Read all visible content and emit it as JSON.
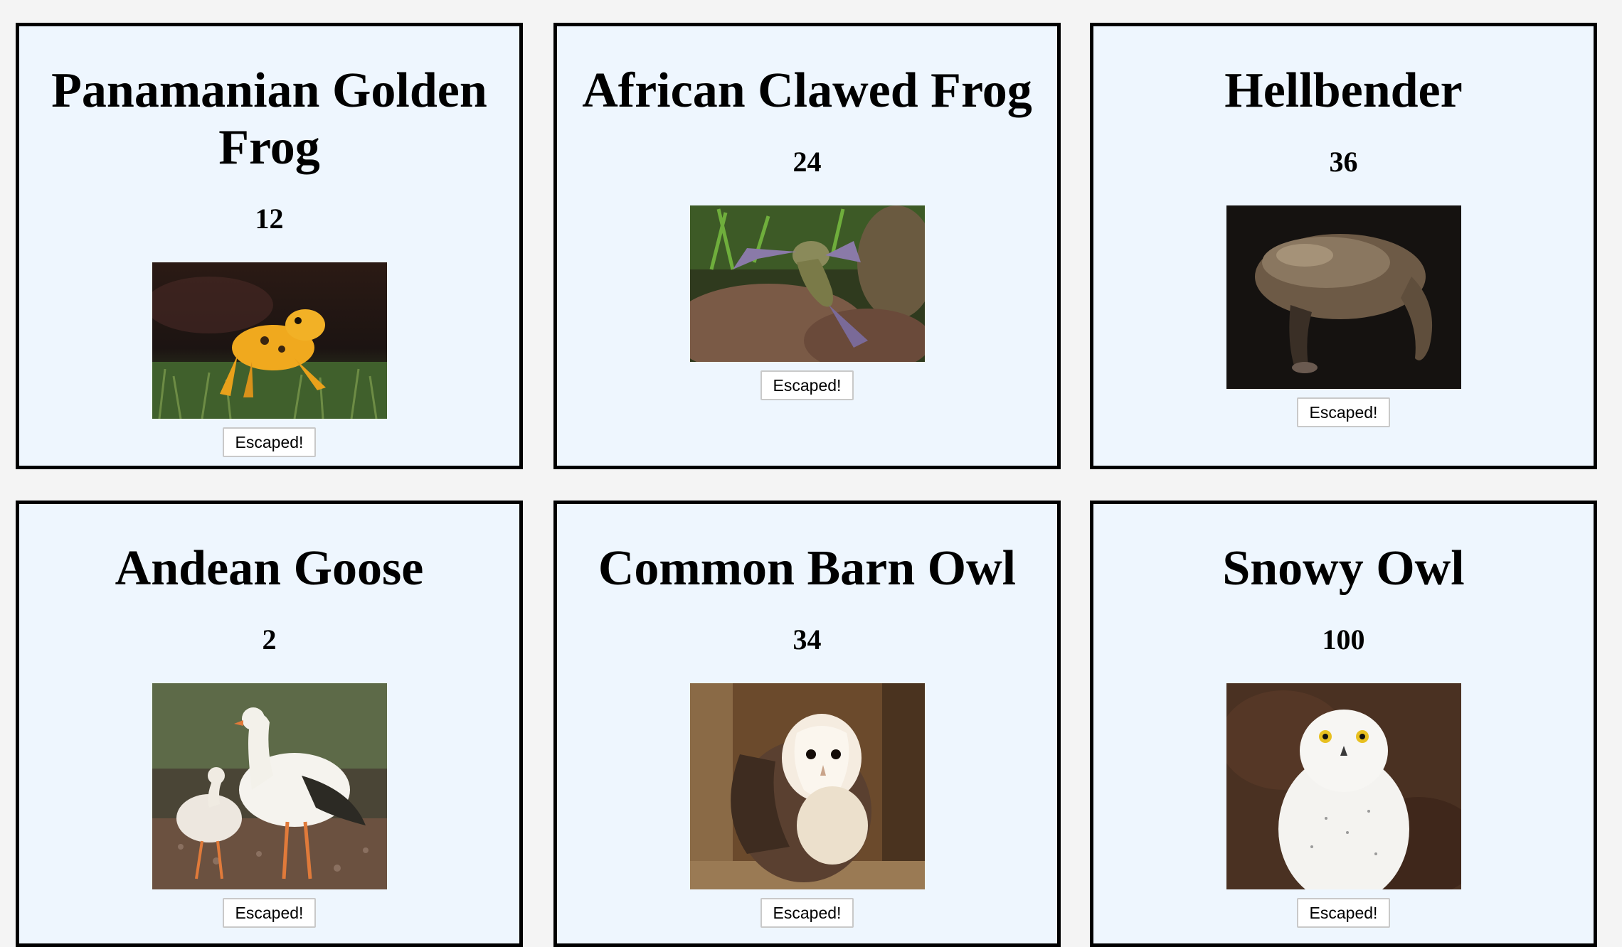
{
  "animals": [
    {
      "name": "Panamanian Golden Frog",
      "count": "12",
      "button_label": "Escaped!",
      "photo": "golden-frog"
    },
    {
      "name": "African Clawed Frog",
      "count": "24",
      "button_label": "Escaped!",
      "photo": "clawed-frog"
    },
    {
      "name": "Hellbender",
      "count": "36",
      "button_label": "Escaped!",
      "photo": "hellbender"
    },
    {
      "name": "Andean Goose",
      "count": "2",
      "button_label": "Escaped!",
      "photo": "andean-goose"
    },
    {
      "name": "Common Barn Owl",
      "count": "34",
      "button_label": "Escaped!",
      "photo": "barn-owl"
    },
    {
      "name": "Snowy Owl",
      "count": "100",
      "button_label": "Escaped!",
      "photo": "snowy-owl"
    }
  ]
}
